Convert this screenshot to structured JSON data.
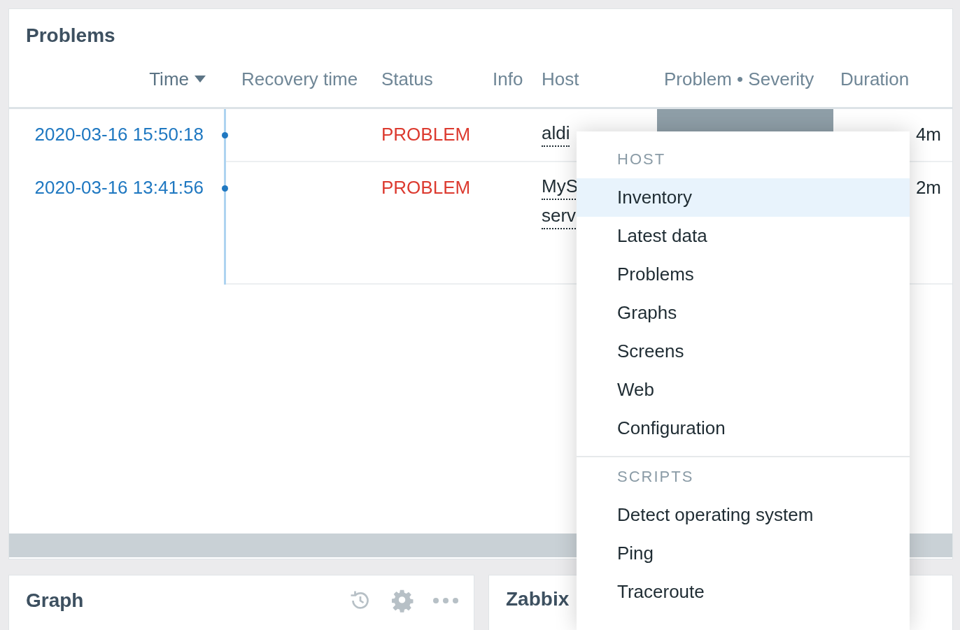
{
  "problems_widget": {
    "title": "Problems",
    "columns": [
      {
        "label": "Time",
        "sorted": true
      },
      {
        "label": "Recovery time",
        "sorted": false
      },
      {
        "label": "Status",
        "sorted": false
      },
      {
        "label": "Info",
        "sorted": false
      },
      {
        "label": "Host",
        "sorted": false
      },
      {
        "label": "Problem • Severity",
        "sorted": false
      },
      {
        "label": "Duration",
        "sorted": false
      }
    ],
    "rows": [
      {
        "time": "2020-03-16 15:50:18",
        "status": "PROBLEM",
        "host": [
          "aldi"
        ],
        "problem_highlighted": true,
        "duration": "4m"
      },
      {
        "time": "2020-03-16 13:41:56",
        "status": "PROBLEM",
        "host": [
          "MyS",
          "serv"
        ],
        "duration": "2m"
      }
    ]
  },
  "bottom_widgets": [
    {
      "title": "Graph",
      "kind": "graph"
    },
    {
      "title": "Zabbix",
      "kind": "plain"
    }
  ],
  "context_menu": {
    "sections": [
      {
        "title": "HOST",
        "items": [
          {
            "label": "Inventory",
            "selected": true
          },
          {
            "label": "Latest data",
            "selected": false
          },
          {
            "label": "Problems",
            "selected": false
          },
          {
            "label": "Graphs",
            "selected": false
          },
          {
            "label": "Screens",
            "selected": false
          },
          {
            "label": "Web",
            "selected": false
          },
          {
            "label": "Configuration",
            "selected": false
          }
        ]
      },
      {
        "title": "SCRIPTS",
        "items": [
          {
            "label": "Detect operating system",
            "selected": false
          },
          {
            "label": "Ping",
            "selected": false
          },
          {
            "label": "Traceroute",
            "selected": false
          }
        ]
      }
    ]
  }
}
